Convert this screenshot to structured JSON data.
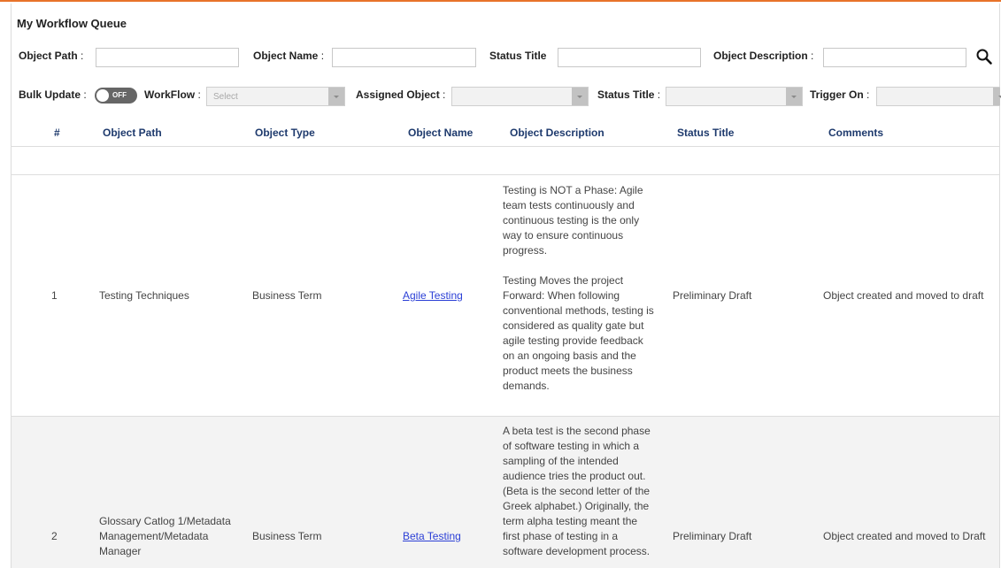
{
  "page": {
    "title": "My Workflow Queue"
  },
  "filters": {
    "object_path_label": "Object Path",
    "object_name_label": "Object Name",
    "status_title_label": "Status Title",
    "object_description_label": "Object Description",
    "object_path_value": "",
    "object_name_value": "",
    "status_title_value": "",
    "object_description_value": ""
  },
  "bulk": {
    "bulk_update_label": "Bulk Update",
    "toggle_text": "OFF",
    "workflow_label": "WorkFlow",
    "workflow_placeholder": "Select",
    "assigned_object_label": "Assigned Object",
    "status_title_label": "Status Title",
    "trigger_on_label": "Trigger On"
  },
  "table": {
    "headers": {
      "num": "#",
      "path": "Object Path",
      "type": "Object Type",
      "name": "Object Name",
      "description": "Object Description",
      "status": "Status Title",
      "comments": "Comments"
    },
    "rows": [
      {
        "num": "1",
        "path": "Testing Techniques",
        "type": "Business Term",
        "name": "Agile Testing",
        "description": "Testing is NOT a Phase: Agile\nteam tests continuously and\ncontinuous testing is the only\nway to ensure continuous\nprogress.\n\nTesting Moves the project\nForward: When following\nconventional methods, testing is\nconsidered as quality gate but\nagile testing provide feedback\non an ongoing basis and the\nproduct meets the business\ndemands.",
        "status": "Preliminary Draft",
        "comments": "Object created and moved to draft"
      },
      {
        "num": "2",
        "path": "Glossary Catlog 1/Metadata\nManagement/Metadata\nManager",
        "type": "Business Term",
        "name": "Beta Testing",
        "description": "A beta test is the second phase\nof software testing in which a\nsampling of the intended\naudience tries the product out.\n(Beta is the second letter of the\nGreek alphabet.) Originally, the\nterm alpha testing meant the\nfirst phase of testing in a\nsoftware development process.",
        "status": "Preliminary Draft",
        "comments": "Object created and moved to Draft"
      }
    ]
  },
  "colors": {
    "accent_top_border": "#e8732a",
    "header_text": "#1e3a6d",
    "link": "#2b3fd6"
  },
  "icons": {
    "search": "search-icon",
    "dropdown": "chevron-down-icon"
  }
}
